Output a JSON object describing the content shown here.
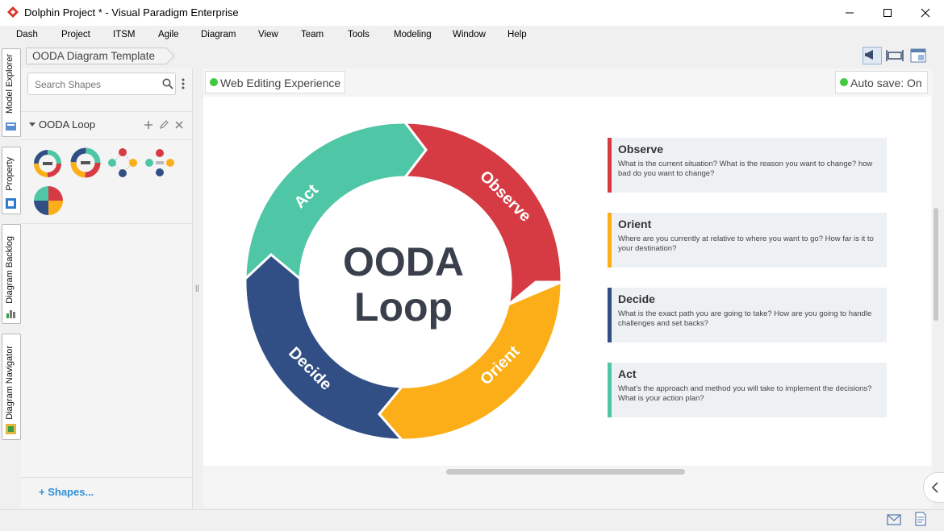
{
  "window": {
    "title": "Dolphin Project * - Visual Paradigm Enterprise",
    "minimize": "—",
    "maximize": "☐",
    "close": "✕"
  },
  "menu": [
    "Dash",
    "Project",
    "ITSM",
    "Agile",
    "Diagram",
    "View",
    "Team",
    "Tools",
    "Modeling",
    "Window",
    "Help"
  ],
  "side_tabs": [
    "Model Explorer",
    "Property",
    "Diagram Backlog",
    "Diagram Navigator"
  ],
  "breadcrumb": "OODA Diagram Template",
  "search": {
    "placeholder": "Search Shapes"
  },
  "shape_group": {
    "title": "OODA Loop"
  },
  "shapes_link": "Shapes...",
  "editing_badge": "Web Editing Experience",
  "autosave_badge": "Auto save: On",
  "colors": {
    "observe": "#d63b44",
    "orient": "#fbae17",
    "decide": "#314f85",
    "act": "#4fc6a6",
    "status_green": "#3ec93e"
  },
  "diagram": {
    "center_line1": "OODA",
    "center_line2": "Loop",
    "segments": {
      "observe": "Observe",
      "orient": "Orient",
      "decide": "Decide",
      "act": "Act"
    },
    "cards": [
      {
        "title": "Observe",
        "desc": "What is the current situation? What is the reason you want to change? how bad do you want to change?",
        "color": "#d63b44"
      },
      {
        "title": "Orient",
        "desc": "Where are you currently at relative to where you want to go? How far is it to your destination?",
        "color": "#fbae17"
      },
      {
        "title": "Decide",
        "desc": "What is the exact path you are going to take? How are you going to handle challenges and set backs?",
        "color": "#314f85"
      },
      {
        "title": "Act",
        "desc": "What's the approach and method you will take to implement the decisions? What is your action plan?",
        "color": "#4fc6a6"
      }
    ]
  }
}
